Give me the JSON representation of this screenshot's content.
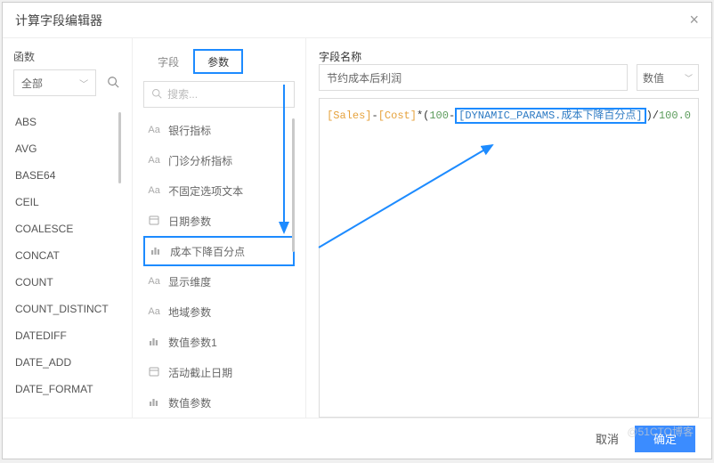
{
  "modal": {
    "title": "计算字段编辑器"
  },
  "left": {
    "section_title": "函数",
    "filter_value": "全部",
    "functions": [
      "ABS",
      "AVG",
      "BASE64",
      "CEIL",
      "COALESCE",
      "CONCAT",
      "COUNT",
      "COUNT_DISTINCT",
      "DATEDIFF",
      "DATE_ADD",
      "DATE_FORMAT"
    ]
  },
  "mid": {
    "tabs": {
      "field": "字段",
      "param": "参数"
    },
    "search_placeholder": "搜索...",
    "params": [
      {
        "icon": "Aa",
        "label": "银行指标"
      },
      {
        "icon": "Aa",
        "label": "门诊分析指标"
      },
      {
        "icon": "Aa",
        "label": "不固定选项文本"
      },
      {
        "icon": "cal",
        "label": "日期参数"
      },
      {
        "icon": "bar",
        "label": "成本下降百分点",
        "highlight": true
      },
      {
        "icon": "Aa",
        "label": "显示维度"
      },
      {
        "icon": "Aa",
        "label": "地域参数"
      },
      {
        "icon": "bar",
        "label": "数值参数1"
      },
      {
        "icon": "cal",
        "label": "活动截止日期"
      },
      {
        "icon": "bar",
        "label": "数值参数"
      }
    ]
  },
  "right": {
    "label": "字段名称",
    "name_value": "节约成本后利润",
    "type_value": "数值",
    "expr": {
      "f1": "[Sales]",
      "op1": "-",
      "f2": "[Cost]",
      "op2": "*(",
      "n1": "100",
      "op3": "-",
      "dyn": "[DYNAMIC_PARAMS.成本下降百分点]",
      "op4": ")/",
      "n2": "100.0"
    }
  },
  "footer": {
    "cancel": "取消",
    "ok": "确定"
  },
  "watermark": "@51CTO博客"
}
